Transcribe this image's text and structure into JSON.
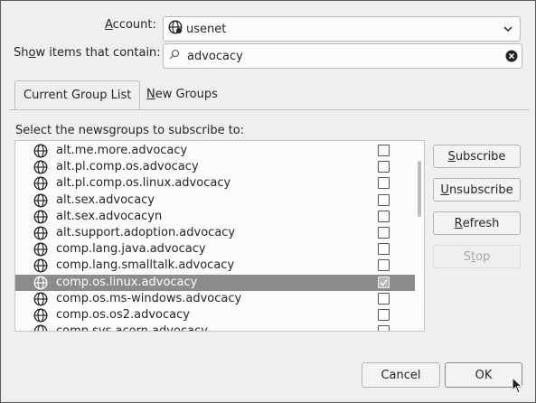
{
  "account": {
    "label_pre": "",
    "label_key": "A",
    "label_post": "ccount:",
    "value": "usenet"
  },
  "filter": {
    "label_pre": "Sh",
    "label_key": "o",
    "label_post": "w items that contain:",
    "value": "advocacy"
  },
  "tabs": [
    {
      "label": "Current Group List",
      "key": ""
    },
    {
      "label_key": "N",
      "label_post": "ew Groups"
    }
  ],
  "prompt": "Select the newsgroups to subscribe to:",
  "groups": [
    {
      "name": "alt.me.more.advocacy",
      "checked": false,
      "selected": false
    },
    {
      "name": "alt.pl.comp.os.advocacy",
      "checked": false,
      "selected": false
    },
    {
      "name": "alt.pl.comp.os.linux.advocacy",
      "checked": false,
      "selected": false
    },
    {
      "name": "alt.sex.advocacy",
      "checked": false,
      "selected": false
    },
    {
      "name": "alt.sex.advocacyn",
      "checked": false,
      "selected": false
    },
    {
      "name": "alt.support.adoption.advocacy",
      "checked": false,
      "selected": false
    },
    {
      "name": "comp.lang.java.advocacy",
      "checked": false,
      "selected": false
    },
    {
      "name": "comp.lang.smalltalk.advocacy",
      "checked": false,
      "selected": false
    },
    {
      "name": "comp.os.linux.advocacy",
      "checked": true,
      "selected": true
    },
    {
      "name": "comp.os.ms-windows.advocacy",
      "checked": false,
      "selected": false
    },
    {
      "name": "comp.os.os2.advocacy",
      "checked": false,
      "selected": false
    },
    {
      "name": "comp.sys.acorn.advocacy",
      "checked": false,
      "selected": false
    }
  ],
  "buttons": {
    "subscribe": {
      "key": "S",
      "rest": "ubscribe"
    },
    "unsubscribe": {
      "key": "U",
      "rest": "nsubscribe"
    },
    "refresh": {
      "key": "R",
      "rest": "efresh"
    },
    "stop": {
      "pre": "S",
      "key": "t",
      "rest": "op"
    },
    "cancel": "Cancel",
    "ok": "OK"
  }
}
